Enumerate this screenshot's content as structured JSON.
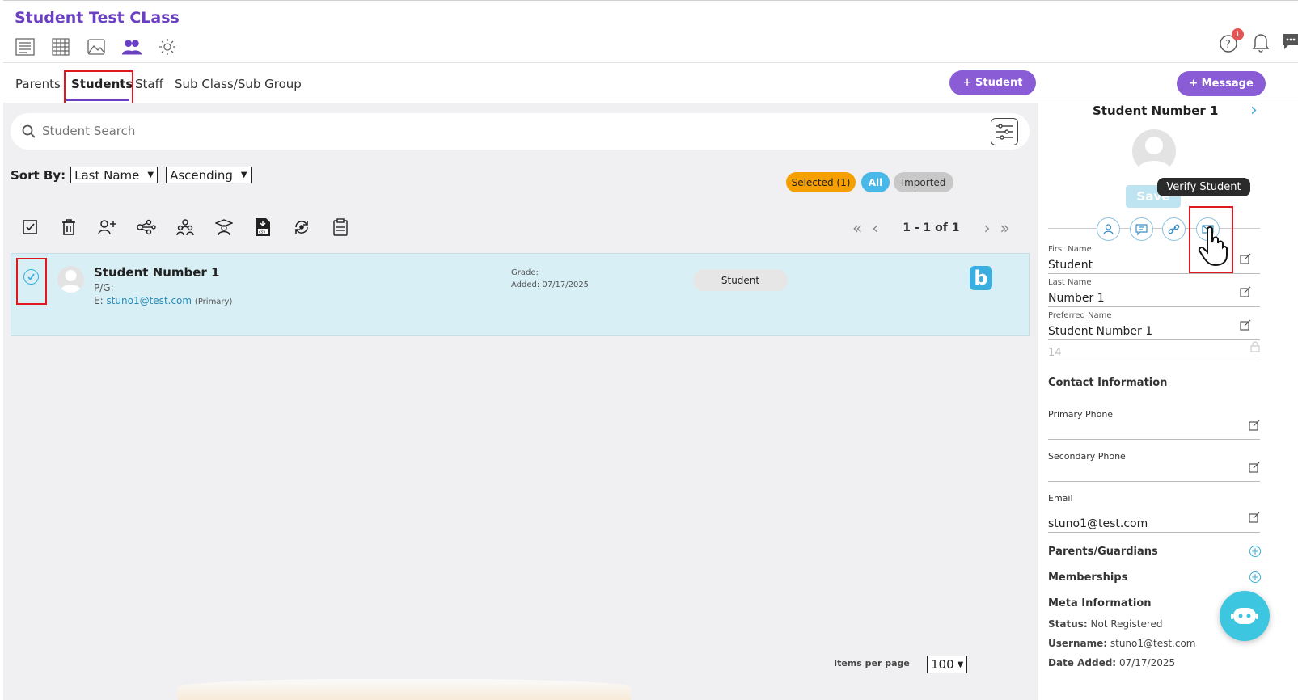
{
  "header": {
    "title": "Student Test CLass",
    "notification_count": "1"
  },
  "tabs": [
    {
      "label": "Parents"
    },
    {
      "label": "Students"
    },
    {
      "label": "Staff"
    },
    {
      "label": "Sub Class/Sub Group"
    }
  ],
  "actions": {
    "add_student": "+ Student",
    "message": "+ Message"
  },
  "search": {
    "placeholder": "Student Search"
  },
  "sort": {
    "label": "Sort By:",
    "field": "Last Name",
    "order": "Ascending"
  },
  "filters": {
    "selected": "Selected (1)",
    "all": "All",
    "imported": "Imported"
  },
  "pagination": {
    "range": "1 - 1 of 1",
    "items_per_page_label": "Items per page",
    "items_per_page": "100"
  },
  "student_row": {
    "name": "Student Number 1",
    "pg": "P/G:",
    "email_prefix": "E:",
    "email": "stuno1@test.com",
    "email_tag": "(Primary)",
    "grade": "Grade:",
    "added": "Added: 07/17/2025",
    "role": "Student",
    "app_logo": "b"
  },
  "panel": {
    "title": "Student Number 1",
    "save": "Save",
    "tooltip": "Verify Student",
    "fields": [
      {
        "label": "First Name",
        "value": "Student"
      },
      {
        "label": "Last Name",
        "value": "Number 1"
      },
      {
        "label": "Preferred Name",
        "value": "Student Number 1"
      }
    ],
    "locked_value": "14",
    "contact_title": "Contact Information",
    "primary_phone": "Primary Phone",
    "secondary_phone": "Secondary Phone",
    "email_label": "Email",
    "email_value": "stuno1@test.com",
    "parents_title": "Parents/Guardians",
    "memberships_title": "Memberships",
    "meta_title": "Meta Information",
    "status_label": "Status:",
    "status_value": "Not Registered",
    "username_label": "Username:",
    "username_value": "stuno1@test.com",
    "date_label": "Date Added:",
    "date_value": "07/17/2025"
  },
  "colors": {
    "brand_purple": "#6b3fc4",
    "button_purple": "#8a5cd6",
    "row_highlight": "#d8eff5",
    "accent_blue": "#3aaee0",
    "selected_chip": "#f5a000"
  }
}
